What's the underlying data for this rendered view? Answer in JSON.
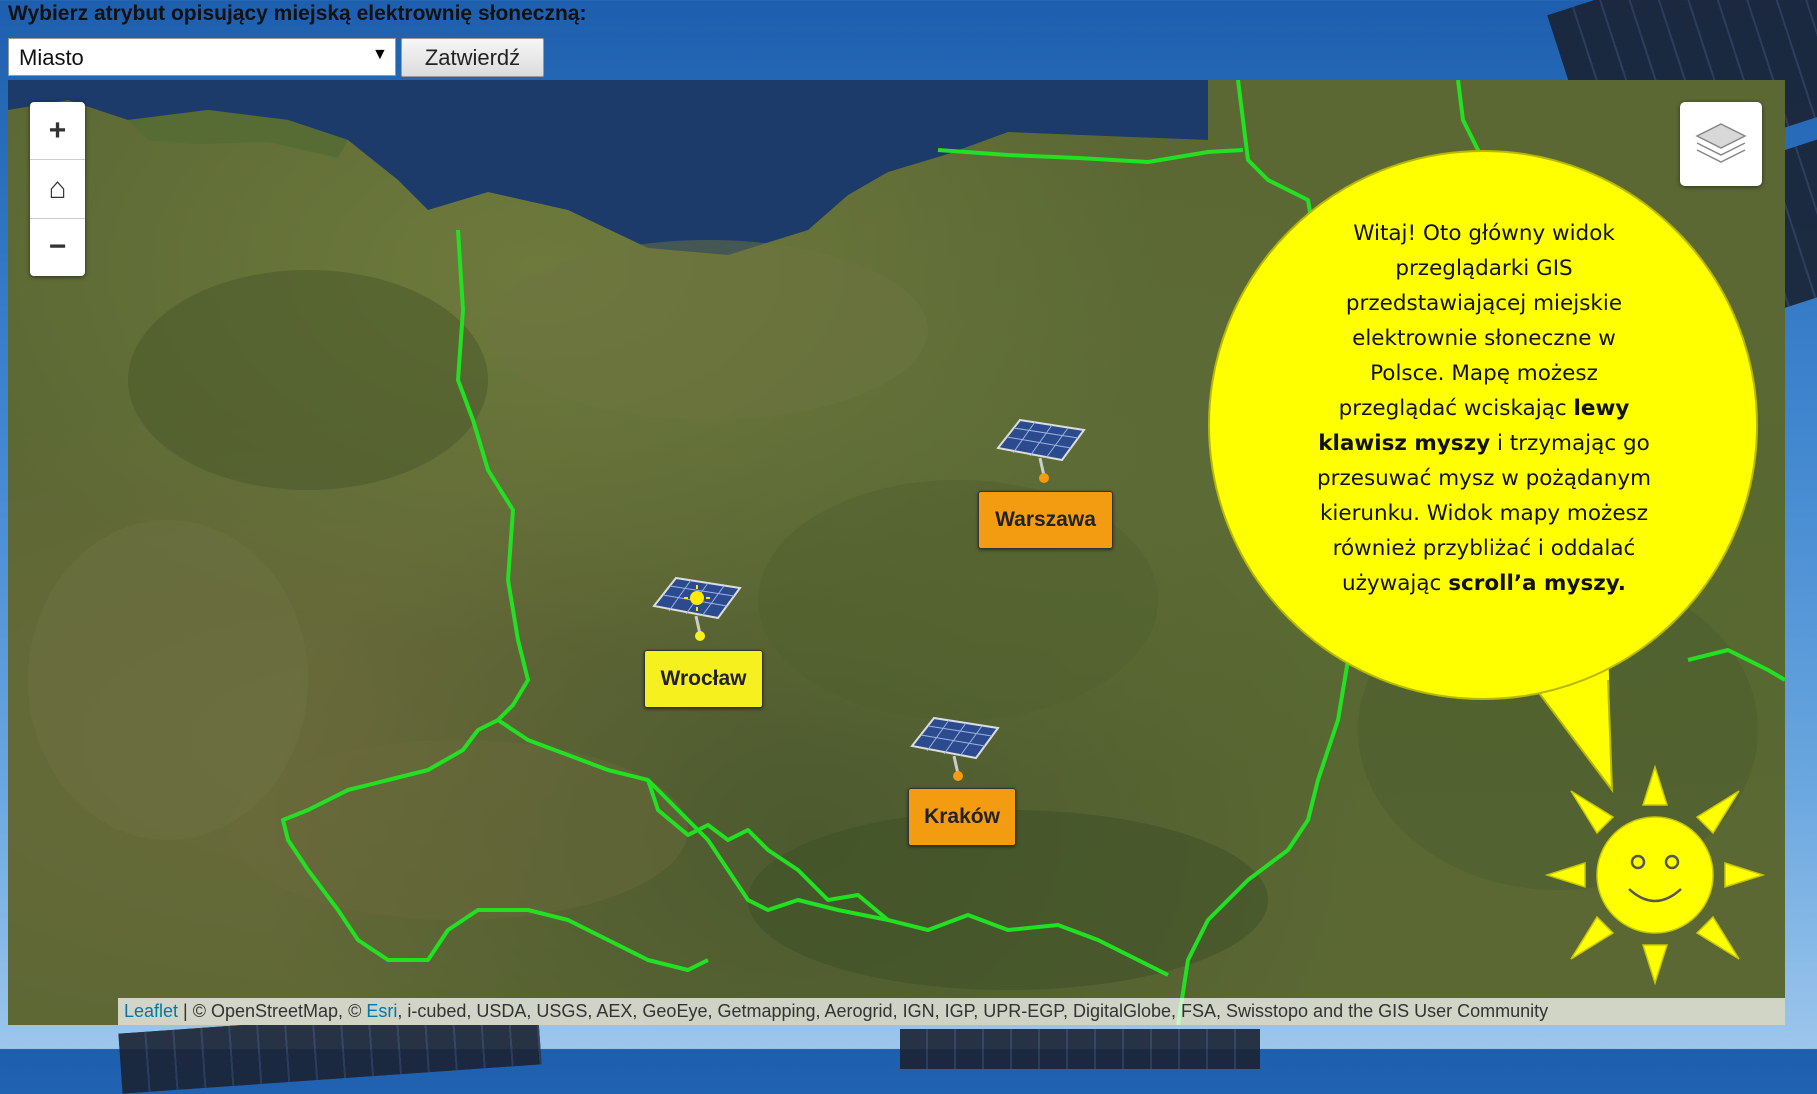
{
  "header": {
    "title": "Wybierz atrybut opisujący miejską elektrownię słoneczną:",
    "select_value": "Miasto",
    "submit_label": "Zatwierdź"
  },
  "map_controls": {
    "zoom_in": "+",
    "home": "⌂",
    "zoom_out": "−"
  },
  "markers": [
    {
      "city": "Warszawa",
      "label_color": "#f39c12",
      "icon": "solar-panel-icon"
    },
    {
      "city": "Wrocław",
      "label_color": "#f6f01e",
      "icon": "solar-panel-sun-icon"
    },
    {
      "city": "Kraków",
      "label_color": "#f39c12",
      "icon": "solar-panel-icon"
    }
  ],
  "bubble": {
    "lines": [
      {
        "text": "Witaj! Oto główny widok"
      },
      {
        "text": "przeglądarki GIS"
      },
      {
        "text": "przedstawiającej miejskie"
      },
      {
        "text": "elektrownie słoneczne w"
      },
      {
        "text": "Polsce. Mapę możesz"
      },
      {
        "text": "przeglądać wciskając ",
        "bold": "lewy"
      },
      {
        "bold": "klawisz myszy",
        "text": " i trzymając go"
      },
      {
        "text": "przesuwać mysz w pożądanym"
      },
      {
        "text": "kierunku. Widok mapy możesz"
      },
      {
        "text": "również przybliżać i oddalać"
      },
      {
        "text": "używając ",
        "bold": "scroll’a myszy."
      }
    ]
  },
  "attribution": {
    "leaflet": "Leaflet",
    "sep": " | © OpenStreetMap, © ",
    "esri": "Esri",
    "rest": ", i-cubed, USDA, USGS, AEX, GeoEye, Getmapping, Aerogrid, IGN, IGP, UPR-EGP, DigitalGlobe, FSA, Swisstopo and the GIS User Community"
  },
  "colors": {
    "border_line": "#22e022",
    "bubble": "#ffff00",
    "sun": "#ffff00"
  }
}
